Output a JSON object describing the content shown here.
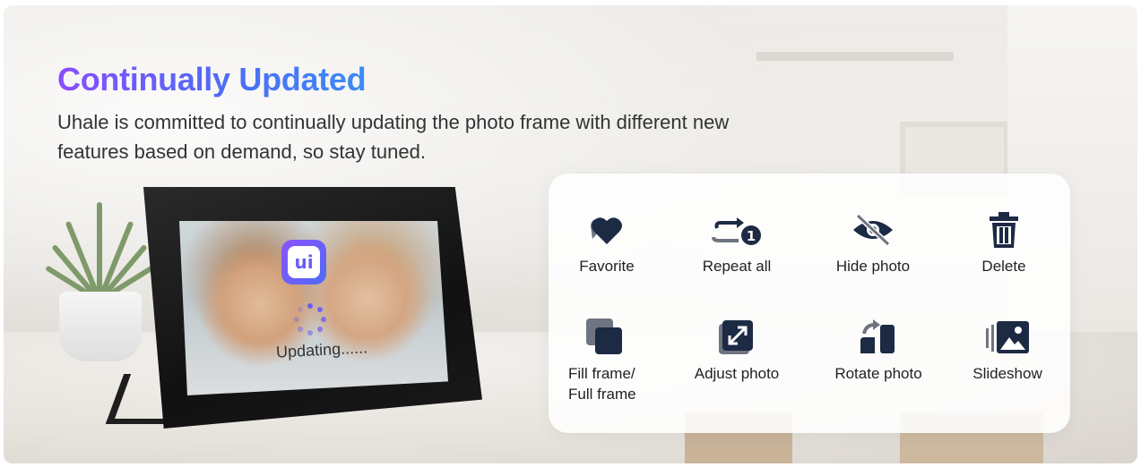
{
  "headline": "Continually Updated",
  "description": "Uhale is committed to continually updating the photo frame with different new features based on demand, so stay tuned.",
  "frame_screen": {
    "app_logo_text": "ui",
    "status_text": "Updating......"
  },
  "features": [
    {
      "label": "Favorite",
      "icon": "heart-icon"
    },
    {
      "label": "Repeat all",
      "icon": "repeat-one-icon"
    },
    {
      "label": "Hide photo",
      "icon": "eye-off-icon"
    },
    {
      "label": "Delete",
      "icon": "trash-icon"
    },
    {
      "label_line1": "Fill frame/",
      "label_line2": "Full frame",
      "icon": "fill-frame-icon"
    },
    {
      "label": "Adjust photo",
      "icon": "resize-icon"
    },
    {
      "label": "Rotate photo",
      "icon": "rotate-icon"
    },
    {
      "label": "Slideshow",
      "icon": "slideshow-icon"
    }
  ],
  "colors": {
    "headline_gradient_start": "#8a4dff",
    "headline_gradient_end": "#3c8cf5",
    "icon_color": "#1c2a44",
    "logo_accent": "#6a5cf8"
  }
}
